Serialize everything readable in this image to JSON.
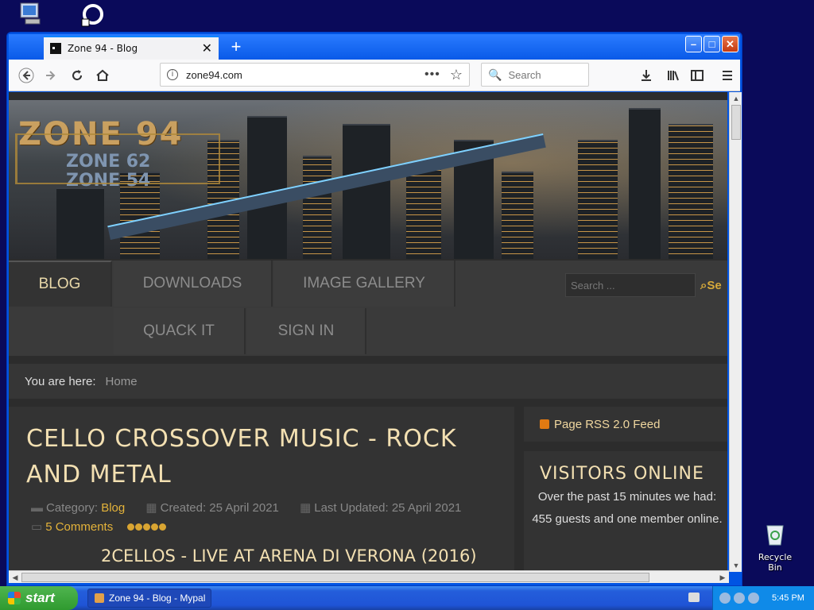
{
  "desktop": {
    "recycle_bin_label": "Recycle Bin"
  },
  "browser": {
    "tab_title": "Zone 94 - Blog",
    "tab_close": "✕",
    "new_tab": "+",
    "url": "zone94.com",
    "url_dots": "•••",
    "search_placeholder": "Search",
    "window_buttons": {
      "minimize": "–",
      "maximize": "□",
      "close": "✕"
    }
  },
  "site": {
    "logo_main": "ZONE 94",
    "logo_sub1": "ZONE 62",
    "logo_sub2": "ZONE 54",
    "menu": {
      "blog": "BLOG",
      "downloads": "DOWNLOADS",
      "image_gallery": "IMAGE GALLERY",
      "quack_it": "QUACK IT",
      "sign_in": "SIGN IN"
    },
    "search_placeholder": "Search ...",
    "search_button": "Se",
    "breadcrumb_label": "You are here:",
    "breadcrumb_home": "Home",
    "article": {
      "title": "CELLO CROSSOVER MUSIC - ROCK AND METAL",
      "category_label": "Category:",
      "category": "Blog",
      "created": "Created: 25 April 2021",
      "updated": "Last Updated: 25 April 2021",
      "comments": "5 Comments",
      "subtitle": "2CELLOS - LIVE AT ARENA DI VERONA (2016)"
    },
    "sidebar": {
      "rss": "Page RSS 2.0 Feed",
      "visitors_title": "VISITORS ONLINE",
      "visitors_line1": "Over the past 15 minutes we had:",
      "visitors_line2": "455 guests and one member online."
    }
  },
  "taskbar": {
    "start": "start",
    "task_label": "Zone 94 - Blog - Mypal",
    "clock": "5:45 PM"
  }
}
